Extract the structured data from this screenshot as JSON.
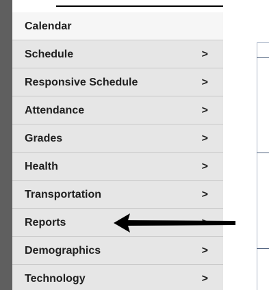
{
  "sidebar": {
    "items": [
      {
        "label": "Calendar",
        "chevron": ""
      },
      {
        "label": "Schedule",
        "chevron": ">"
      },
      {
        "label": "Responsive Schedule",
        "chevron": ">"
      },
      {
        "label": "Attendance",
        "chevron": ">"
      },
      {
        "label": "Grades",
        "chevron": ">"
      },
      {
        "label": "Health",
        "chevron": ">"
      },
      {
        "label": "Transportation",
        "chevron": ">"
      },
      {
        "label": "Reports",
        "chevron": ">"
      },
      {
        "label": "Demographics",
        "chevron": ">"
      },
      {
        "label": "Technology",
        "chevron": ">"
      }
    ]
  },
  "annotation": {
    "arrow_icon": "left-arrow",
    "arrow_color": "#000000"
  },
  "colors": {
    "item_background": "#e6e6e6",
    "first_item_background": "#f6f6f6",
    "sidebar_edge": "#5f5f5f"
  }
}
